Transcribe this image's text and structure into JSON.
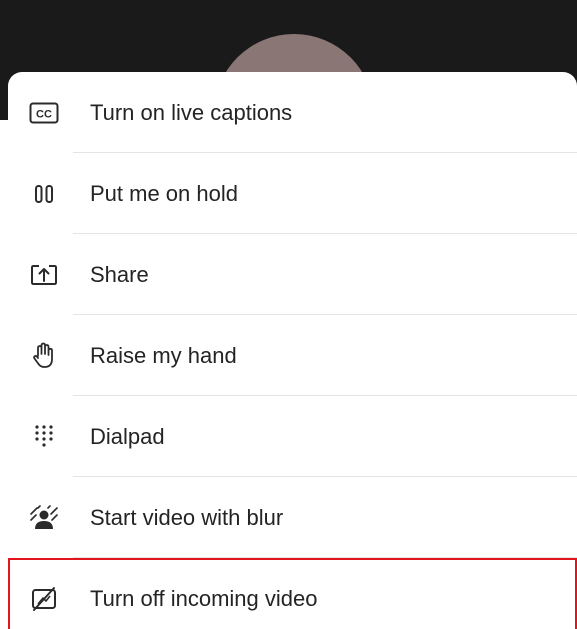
{
  "menu": {
    "items": [
      {
        "label": "Turn on live captions",
        "icon": "cc-icon"
      },
      {
        "label": "Put me on hold",
        "icon": "pause-icon"
      },
      {
        "label": "Share",
        "icon": "share-icon"
      },
      {
        "label": "Raise my hand",
        "icon": "hand-icon"
      },
      {
        "label": "Dialpad",
        "icon": "dialpad-icon"
      },
      {
        "label": "Start video with blur",
        "icon": "blur-background-icon"
      },
      {
        "label": "Turn off incoming video",
        "icon": "video-off-icon"
      }
    ]
  },
  "colors": {
    "highlight": "#e2141c",
    "call_background": "#1b1a1a",
    "avatar": "#8a7675"
  }
}
